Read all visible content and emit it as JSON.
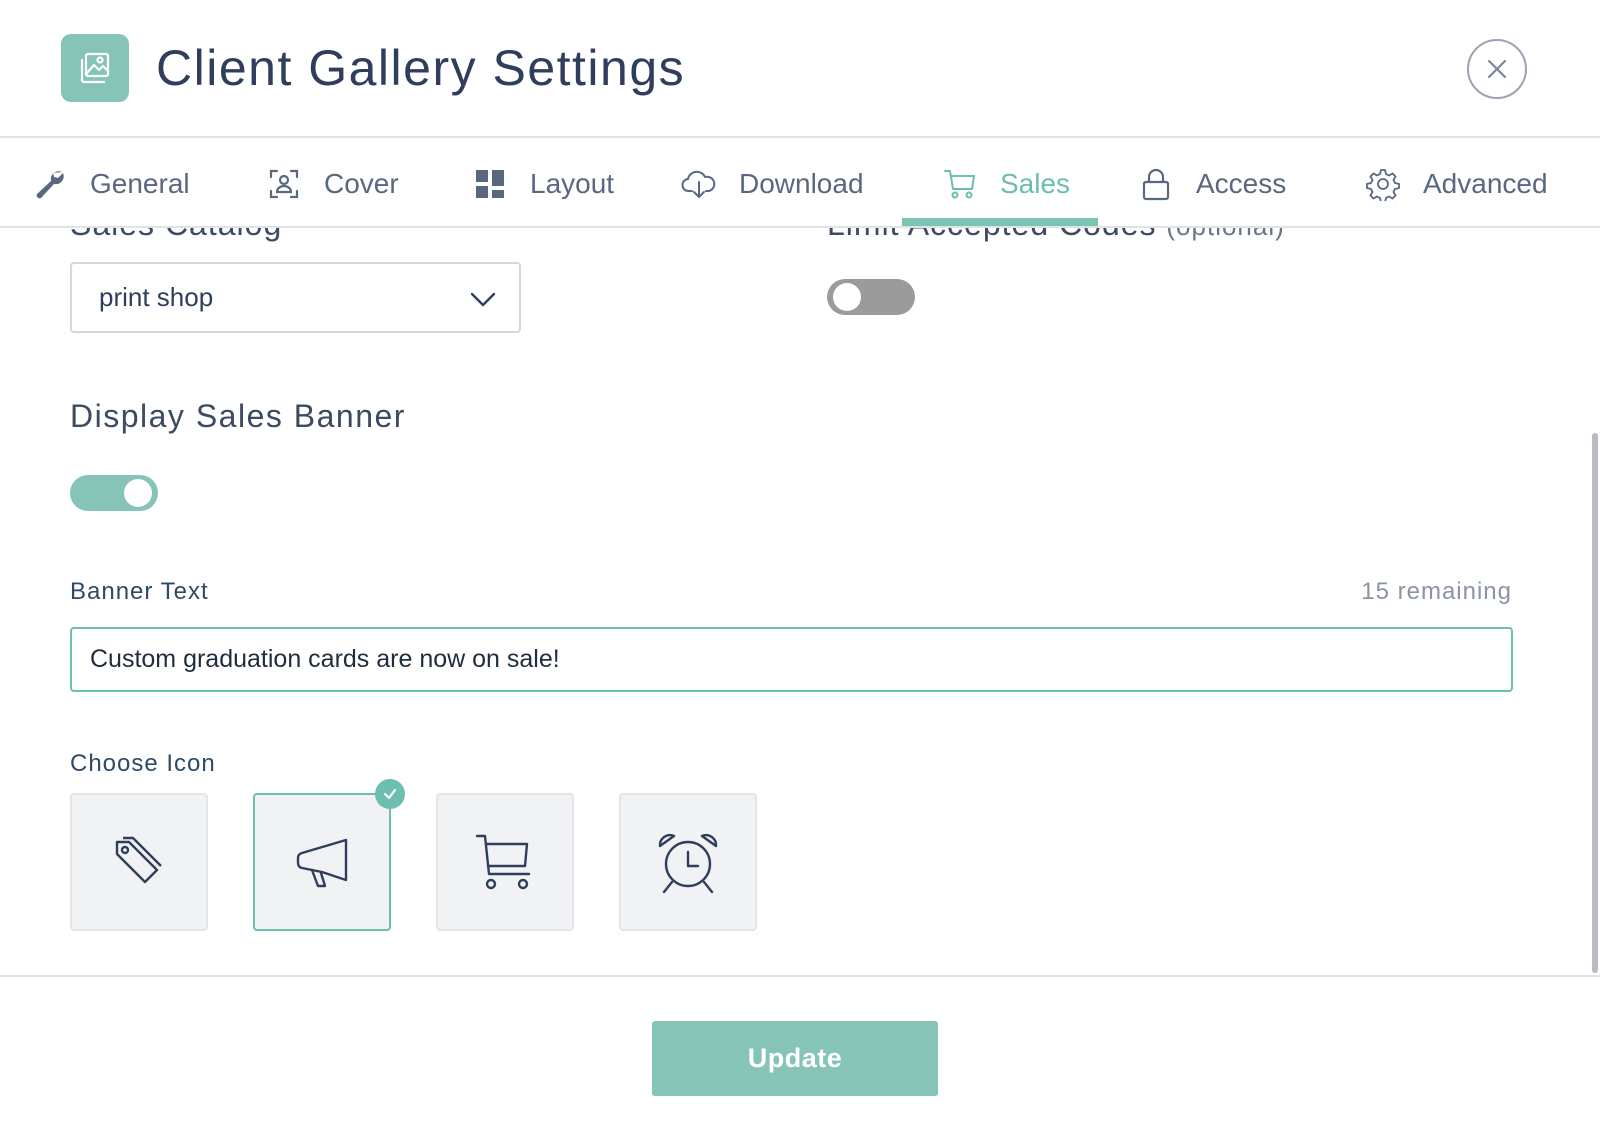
{
  "header": {
    "title": "Client Gallery Settings",
    "icon": "gallery-image-icon",
    "close_icon": "close-icon"
  },
  "tabs": [
    {
      "label": "General",
      "icon": "wrench-icon",
      "active": false
    },
    {
      "label": "Cover",
      "icon": "portrait-frame-icon",
      "active": false
    },
    {
      "label": "Layout",
      "icon": "layout-grid-icon",
      "active": false
    },
    {
      "label": "Download",
      "icon": "cloud-download-icon",
      "active": false
    },
    {
      "label": "Sales",
      "icon": "cart-icon",
      "active": true
    },
    {
      "label": "Access",
      "icon": "lock-icon",
      "active": false
    },
    {
      "label": "Advanced",
      "icon": "gear-icon",
      "active": false
    }
  ],
  "sales": {
    "catalog_label_partial": "Sales Catalog",
    "limit_codes_label_partial": "Limit Accepted Codes",
    "limit_codes_optional": "(optional)",
    "catalog_value": "print shop",
    "limit_codes_enabled": false,
    "banner_heading": "Display Sales Banner",
    "banner_enabled": true,
    "banner_text_label": "Banner Text",
    "banner_remaining": "15 remaining",
    "banner_text_value": "Custom graduation cards are now on sale!",
    "choose_icon_label": "Choose Icon",
    "icon_options": [
      "price-tag-icon",
      "megaphone-icon",
      "shopping-cart-icon",
      "alarm-clock-icon"
    ],
    "selected_icon": "megaphone-icon"
  },
  "footer": {
    "update_label": "Update"
  },
  "colors": {
    "accent": "#6cbfae",
    "accent_fill": "#85c4b6",
    "text_dark": "#2f3e5c",
    "toggle_off": "#9b9b9b"
  }
}
